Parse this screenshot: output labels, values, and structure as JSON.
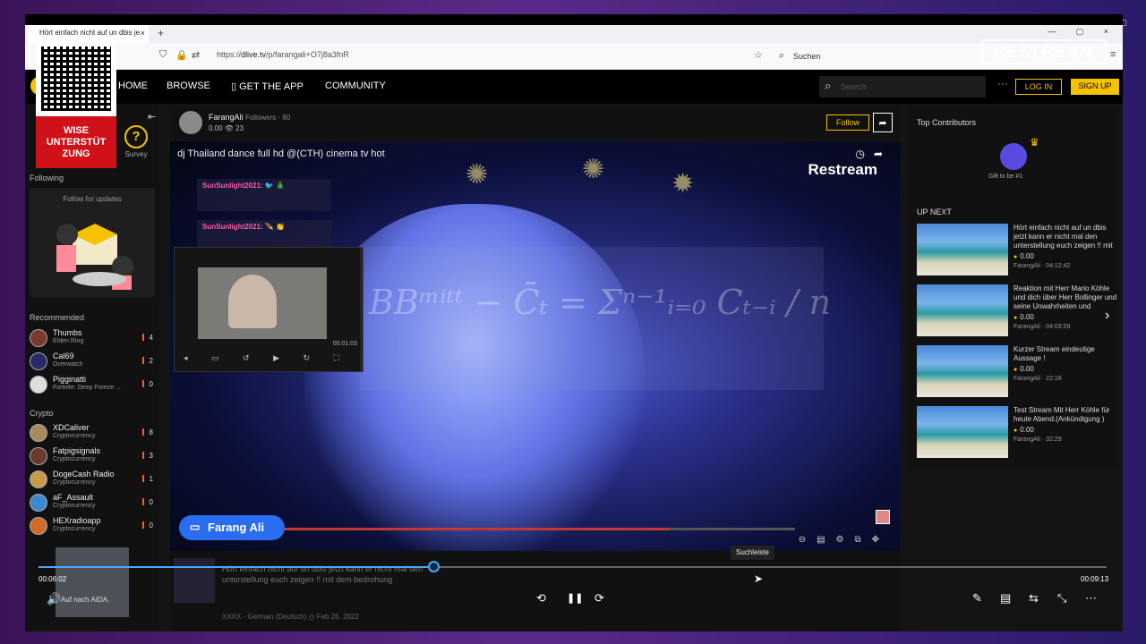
{
  "browser": {
    "tab_title": "Hört einfach nicht auf un dbis je",
    "tab_close": "×",
    "new_tab": "+",
    "url_prefix": "https://",
    "url_host": "dlive.tv",
    "url_path": "/p/farangali+O7j8a3fnR",
    "search_placeholder": "Suchen",
    "window_controls": "— ▢ ×"
  },
  "site": {
    "nav": {
      "home": "HOME",
      "browse": "BROWSE",
      "get_app": "GET THE APP",
      "community": "COMMUNITY",
      "search_placeholder": "Search",
      "more": "···",
      "login": "LOG IN",
      "signup": "SIGN UP"
    },
    "left": {
      "survey_label": "Survey",
      "following_label": "Following",
      "follow_for_updates": "Follow for updates",
      "recommended_label": "Recommended",
      "recommended": [
        {
          "name": "Thumbs",
          "sub": "Elden Ring",
          "count": "4"
        },
        {
          "name": "Cal69",
          "sub": "Overwatch",
          "count": "2"
        },
        {
          "name": "Pigginatti",
          "sub": "Fortnite: Deep Freeze ...",
          "count": "0"
        }
      ],
      "crypto_label": "Crypto",
      "crypto": [
        {
          "name": "XDCaliver",
          "sub": "Cryptocurrency",
          "count": "8"
        },
        {
          "name": "Fatpigsignals",
          "sub": "Cryptocurrency",
          "count": "3"
        },
        {
          "name": "DogeCash Radio",
          "sub": "Cryptocurrency",
          "count": "1"
        },
        {
          "name": "aF_Assault",
          "sub": "Cryptocurrency",
          "count": "0"
        },
        {
          "name": "HEXradioapp",
          "sub": "Cryptocurrency",
          "count": "0"
        }
      ]
    },
    "channel": {
      "name": "FarangAli",
      "followers_label": "Followers · 80",
      "stats": "0.00  👁 23",
      "follow": "Follow",
      "share": "➦"
    },
    "video": {
      "title": "dj Thailand dance full hd @(CTH) cinema tv hot",
      "watermark": "Restream",
      "chat_overlay_1": "SunSunlight2021: 🐦 🎄",
      "chat_overlay_2": "SunSunlight2021: 🪶 👏",
      "formula": "BBᵐⁱᵗᵗ − C̄ₜ = Σⁿ⁻¹ᵢ₌₀ Cₜ₋ᵢ / n",
      "chat_badge": "Farang Ali",
      "pip_time": "00:01:03"
    },
    "below": {
      "title": "Hört einfach nicht auf un dbis jetzt kann er nicht mal den unterstellung euch zeigen !! mit dem bedrohung",
      "meta": "XXXX · German (Deutsch)  ◷ Feb 26, 2022"
    },
    "right": {
      "top_contributors": "Top Contributors",
      "gift_label": "Gift to be #1",
      "up_next": "UP NEXT",
      "videos": [
        {
          "title": "Hört einfach nicht auf un dbis jetzt kann er nicht mal den unterstellung euch zeigen !! mit dem bedr...",
          "value": "0.00",
          "meta": "FarangAli · 04:12:42"
        },
        {
          "title": "Reaktion mit Herr Mario Köhle und dich über Herr Bollinger und seine Unwahrheiten und Unterstell...",
          "value": "0.00",
          "meta": "FarangAli · 04:03:59"
        },
        {
          "title": "Kurzer Stream eindeutige Aussage !",
          "value": "0.00",
          "meta": "FarangAli · 22:18"
        },
        {
          "title": "Test Stream Mit Herr Köhle für heute Abend.(Ankündigung )",
          "value": "0.00",
          "meta": "FarangAli · 32:29"
        }
      ]
    }
  },
  "overlay": {
    "red_box": "WISE UNTERSTÜT ZUNG",
    "restream_logo": "RESTREAM",
    "mini_text": "Auf nach AIDA."
  },
  "player": {
    "current_time": "00:06:02",
    "total_time": "00:09:13",
    "progress": 0.37,
    "tooltip": "Suchleiste",
    "rewind": "⟲",
    "pause": "❚❚",
    "forward": "⟳",
    "volume": "🔊"
  }
}
